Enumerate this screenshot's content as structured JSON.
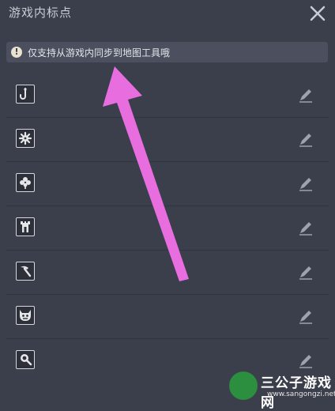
{
  "header": {
    "title": "游戏内标点"
  },
  "notice": {
    "text": "仅支持从游戏内同步到地图工具哦"
  },
  "markers": [
    {
      "icon": "hook-icon"
    },
    {
      "icon": "gear-icon"
    },
    {
      "icon": "clover-icon"
    },
    {
      "icon": "tower-icon"
    },
    {
      "icon": "pickaxe-icon"
    },
    {
      "icon": "demon-mask-icon"
    },
    {
      "icon": "magnifier-icon"
    }
  ],
  "colors": {
    "background": "#3b3e4b",
    "annotation_arrow": "#e86ee0"
  },
  "watermark": {
    "name": "三公子游戏网",
    "url": "www.sangongzi.net"
  }
}
